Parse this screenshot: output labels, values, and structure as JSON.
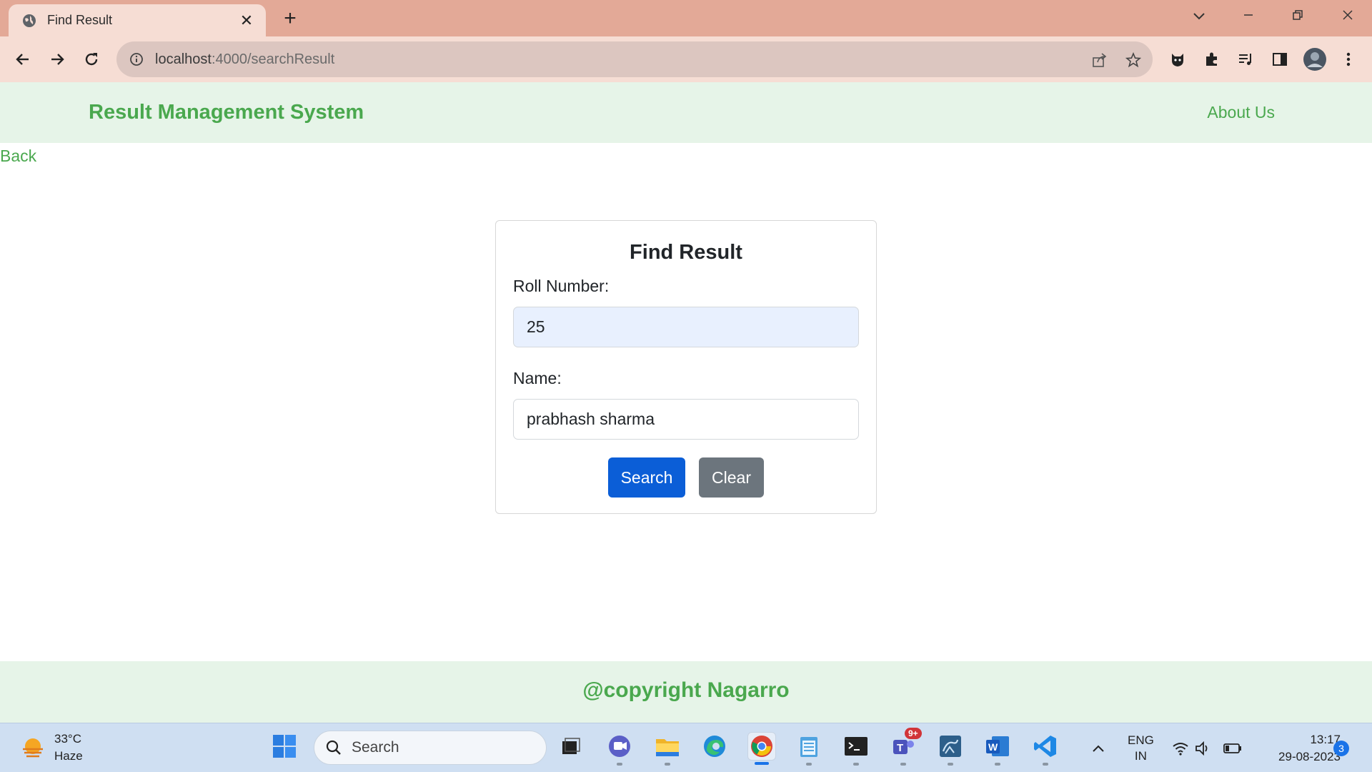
{
  "browser": {
    "tab_title": "Find Result",
    "url_host": "localhost",
    "url_rest": ":4000/searchResult"
  },
  "navbar": {
    "brand": "Result Management System",
    "about": "About Us"
  },
  "back_link": "Back",
  "form": {
    "title": "Find Result",
    "roll_label": "Roll Number:",
    "roll_value": "25",
    "name_label": "Name:",
    "name_value": "prabhash sharma",
    "search_button": "Search",
    "clear_button": "Clear"
  },
  "footer": {
    "text": "@copyright Nagarro"
  },
  "taskbar": {
    "temperature": "33°C",
    "weather": "Haze",
    "search_placeholder": "Search",
    "teams_badge": "9+",
    "lang_line1": "ENG",
    "lang_line2": "IN",
    "time": "13:17",
    "date": "29-08-2023",
    "notification_count": "3"
  },
  "colors": {
    "brand_green": "#4aa84e",
    "navbar_bg": "#e6f4e8",
    "search_btn": "#0b5ed7",
    "clear_btn": "#6c757d",
    "tab_strip": "#e3a997"
  }
}
